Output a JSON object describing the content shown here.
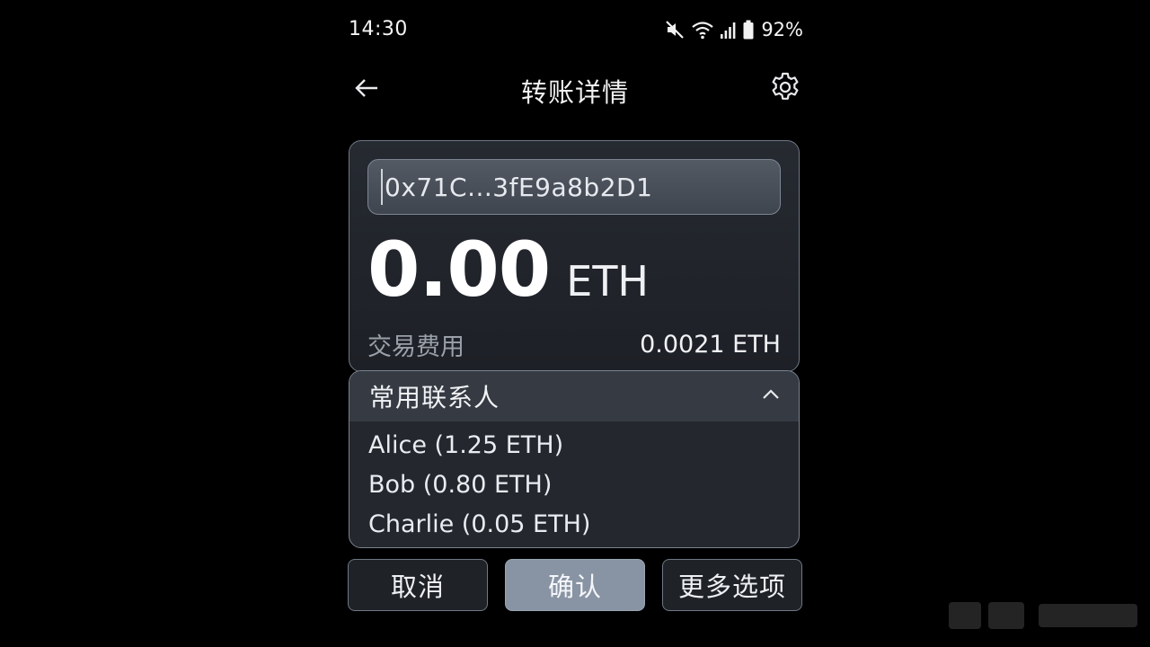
{
  "status_bar": {
    "time": "14:30",
    "battery_percent": "92%",
    "icons": [
      "mute-icon",
      "wifi-icon",
      "signal-icon",
      "battery-icon"
    ]
  },
  "header": {
    "title": "转账详情",
    "back_icon": "arrow-left-icon",
    "settings_icon": "gear-icon"
  },
  "transaction": {
    "address_value": "0x71C...3fE9a8b2D1",
    "amount": "0.00",
    "unit": "ETH",
    "fee_label": "交易费用",
    "fee_value": "0.0021 ETH"
  },
  "contacts": {
    "title": "常用联系人",
    "expanded": true,
    "items": [
      {
        "label": "Alice (1.25 ETH)"
      },
      {
        "label": "Bob (0.80 ETH)"
      },
      {
        "label": "Charlie (0.05 ETH)"
      }
    ]
  },
  "actions": {
    "cancel_label": "取消",
    "confirm_label": "确认",
    "more_label": "更多选项"
  },
  "colors": {
    "background": "#000000",
    "card": "#22252b",
    "confirm_button": "#8893a3",
    "border": "#6f7885"
  }
}
